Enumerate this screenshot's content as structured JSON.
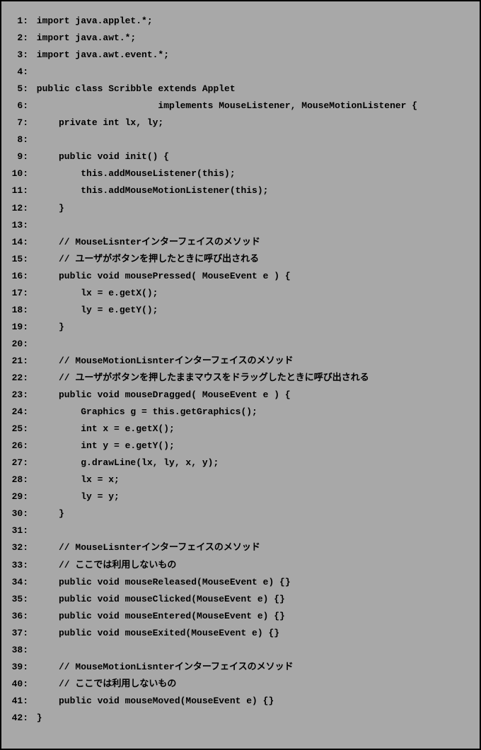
{
  "code_lines": [
    {
      "num": "1:",
      "text": " import java.applet.*;"
    },
    {
      "num": "2:",
      "text": " import java.awt.*;"
    },
    {
      "num": "3:",
      "text": " import java.awt.event.*;"
    },
    {
      "num": "4:",
      "text": ""
    },
    {
      "num": "5:",
      "text": " public class Scribble extends Applet"
    },
    {
      "num": "6:",
      "text": "                       implements MouseListener, MouseMotionListener {"
    },
    {
      "num": "7:",
      "text": "     private int lx, ly;"
    },
    {
      "num": "8:",
      "text": ""
    },
    {
      "num": "9:",
      "text": "     public void init() {"
    },
    {
      "num": "10:",
      "text": "         this.addMouseListener(this);"
    },
    {
      "num": "11:",
      "text": "         this.addMouseMotionListener(this);"
    },
    {
      "num": "12:",
      "text": "     }"
    },
    {
      "num": "13:",
      "text": ""
    },
    {
      "num": "14:",
      "text": "     // MouseLisnterインターフェイスのメソッド"
    },
    {
      "num": "15:",
      "text": "     // ユーザがボタンを押したときに呼び出される"
    },
    {
      "num": "16:",
      "text": "     public void mousePressed( MouseEvent e ) {"
    },
    {
      "num": "17:",
      "text": "         lx = e.getX();"
    },
    {
      "num": "18:",
      "text": "         ly = e.getY();"
    },
    {
      "num": "19:",
      "text": "     }"
    },
    {
      "num": "20:",
      "text": ""
    },
    {
      "num": "21:",
      "text": "     // MouseMotionLisnterインターフェイスのメソッド"
    },
    {
      "num": "22:",
      "text": "     // ユーザがボタンを押したままマウスをドラッグしたときに呼び出される"
    },
    {
      "num": "23:",
      "text": "     public void mouseDragged( MouseEvent e ) {"
    },
    {
      "num": "24:",
      "text": "         Graphics g = this.getGraphics();"
    },
    {
      "num": "25:",
      "text": "         int x = e.getX();"
    },
    {
      "num": "26:",
      "text": "         int y = e.getY();"
    },
    {
      "num": "27:",
      "text": "         g.drawLine(lx, ly, x, y);"
    },
    {
      "num": "28:",
      "text": "         lx = x;"
    },
    {
      "num": "29:",
      "text": "         ly = y;"
    },
    {
      "num": "30:",
      "text": "     }"
    },
    {
      "num": "31:",
      "text": ""
    },
    {
      "num": "32:",
      "text": "     // MouseLisnterインターフェイスのメソッド"
    },
    {
      "num": "33:",
      "text": "     // ここでは利用しないもの"
    },
    {
      "num": "34:",
      "text": "     public void mouseReleased(MouseEvent e) {}"
    },
    {
      "num": "35:",
      "text": "     public void mouseClicked(MouseEvent e) {}"
    },
    {
      "num": "36:",
      "text": "     public void mouseEntered(MouseEvent e) {}"
    },
    {
      "num": "37:",
      "text": "     public void mouseExited(MouseEvent e) {}"
    },
    {
      "num": "38:",
      "text": ""
    },
    {
      "num": "39:",
      "text": "     // MouseMotionLisnterインターフェイスのメソッド"
    },
    {
      "num": "40:",
      "text": "     // ここでは利用しないもの"
    },
    {
      "num": "41:",
      "text": "     public void mouseMoved(MouseEvent e) {}"
    },
    {
      "num": "42:",
      "text": " }"
    }
  ]
}
